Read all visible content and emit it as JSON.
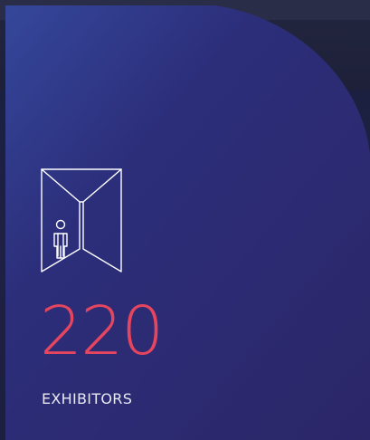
{
  "stat": {
    "value": "220",
    "label": "EXHIBITORS",
    "icon": "exhibition-booth-visitor-icon"
  },
  "colors": {
    "accent": "#e5455e",
    "card_start": "#2f3f93",
    "card_end": "#2a2566",
    "label": "#e8e9f3",
    "icon_stroke": "#ffffff"
  }
}
